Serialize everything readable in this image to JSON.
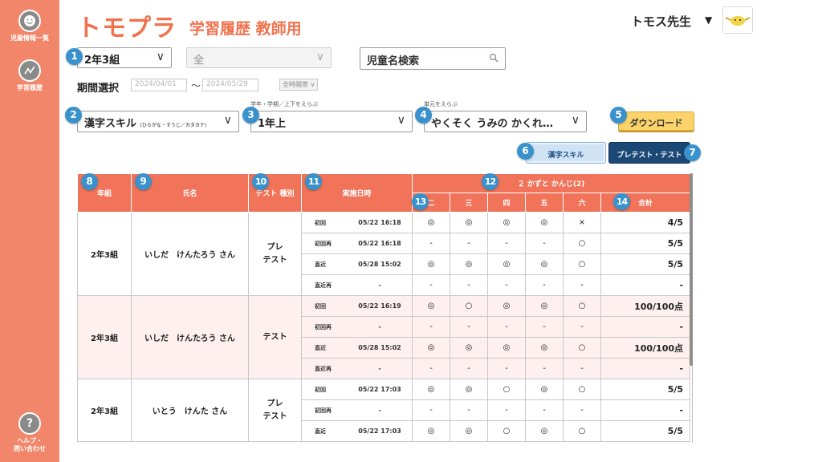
{
  "sidebar": {
    "items": [
      {
        "label": "児童情報一覧",
        "icon": "smiley-icon"
      },
      {
        "label": "学習履歴",
        "icon": "chart-line-icon"
      }
    ],
    "help": {
      "label": "ヘルプ・\n問い合わせ",
      "icon": "question-icon",
      "glyph": "?"
    }
  },
  "header": {
    "logo": "トモプラ",
    "title": "学習履歴 教師用",
    "user_name": "トモス先生",
    "user_caret": "▼"
  },
  "filters": {
    "class_select": "2年3組",
    "all_select": "全",
    "search_placeholder": "児童名検索",
    "period_label": "期間選択",
    "date_from": "2024/04/01",
    "tilde": "～",
    "date_to": "2024/05/29",
    "time_button": "全時間帯 ∨",
    "subject_select_main": "漢字スキル",
    "subject_select_sub": "(ひらがな・すうじ／カタカナ)",
    "term_caption": "学年・学期／上下をえらぶ",
    "term_select": "1年上",
    "unit_caption": "単元をえらぶ",
    "unit_select": "やくそく うみの かくれ…",
    "download_button": "ダウンロード"
  },
  "tabs": [
    {
      "label": "漢字スキル",
      "active": false
    },
    {
      "label": "プレテスト・テスト",
      "active": true
    }
  ],
  "badges": [
    "1",
    "2",
    "3",
    "4",
    "5",
    "6",
    "7",
    "8",
    "9",
    "10",
    "11",
    "12",
    "13",
    "14"
  ],
  "table": {
    "headers": {
      "grade": "年組",
      "name": "氏名",
      "test_type": "テスト 種別",
      "datetime": "実施日時",
      "unit": "２ かずと かんじ(2)",
      "cols": [
        "二",
        "三",
        "四",
        "五",
        "六"
      ],
      "total": "合計"
    },
    "groups": [
      {
        "grade": "2年3組",
        "name": "いしだ　けんたろう さん",
        "test_type": "プレ\nテスト",
        "pink": false,
        "rows": [
          {
            "attempt": "初回",
            "datetime": "05/22 16:18",
            "marks": [
              "◎",
              "◎",
              "◎",
              "◎",
              "×"
            ],
            "total": "4/5"
          },
          {
            "attempt": "初回再",
            "datetime": "05/22 16:18",
            "marks": [
              "-",
              "-",
              "-",
              "-",
              "○"
            ],
            "total": "5/5"
          },
          {
            "attempt": "直近",
            "datetime": "05/28 15:02",
            "marks": [
              "◎",
              "◎",
              "◎",
              "◎",
              "○"
            ],
            "total": "5/5"
          },
          {
            "attempt": "直近再",
            "datetime": "-",
            "marks": [
              "-",
              "-",
              "-",
              "-",
              "-"
            ],
            "total": "-"
          }
        ]
      },
      {
        "grade": "2年3組",
        "name": "いしだ　けんたろう さん",
        "test_type": "テスト",
        "pink": true,
        "rows": [
          {
            "attempt": "初回",
            "datetime": "05/22 16:19",
            "marks": [
              "◎",
              "○",
              "◎",
              "◎",
              "○"
            ],
            "total": "100/100点"
          },
          {
            "attempt": "初回再",
            "datetime": "-",
            "marks": [
              "-",
              "-",
              "-",
              "-",
              "-"
            ],
            "total": "-"
          },
          {
            "attempt": "直近",
            "datetime": "05/28 15:02",
            "marks": [
              "◎",
              "◎",
              "◎",
              "◎",
              "○"
            ],
            "total": "100/100点"
          },
          {
            "attempt": "直近再",
            "datetime": "-",
            "marks": [
              "-",
              "-",
              "-",
              "-",
              "-"
            ],
            "total": "-"
          }
        ]
      },
      {
        "grade": "2年3組",
        "name": "いとう　けんた さん",
        "test_type": "プレ\nテスト",
        "pink": false,
        "rows": [
          {
            "attempt": "初回",
            "datetime": "05/22 17:03",
            "marks": [
              "◎",
              "◎",
              "○",
              "◎",
              "○"
            ],
            "total": "5/5"
          },
          {
            "attempt": "初回再",
            "datetime": "-",
            "marks": [
              "-",
              "-",
              "-",
              "-",
              "-"
            ],
            "total": "-"
          },
          {
            "attempt": "直近",
            "datetime": "05/22 17:03",
            "marks": [
              "◎",
              "◎",
              "○",
              "◎",
              "○"
            ],
            "total": "5/5"
          }
        ]
      }
    ]
  },
  "colors": {
    "sidebar": "#f2866a",
    "accent": "#f0724f",
    "header_cell": "#f0735a",
    "badge": "#3a92cc",
    "tab_active": "#1c4876",
    "download": "#fbd36a"
  }
}
